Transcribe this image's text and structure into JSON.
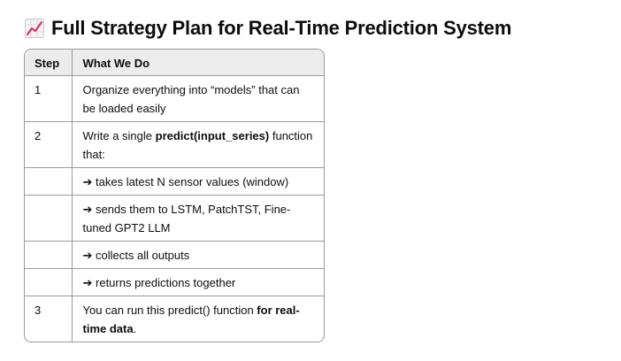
{
  "heading": {
    "icon": "chart-increasing-icon",
    "title": "Full Strategy Plan for Real-Time Prediction System"
  },
  "table": {
    "headers": {
      "step": "Step",
      "what": "What We Do"
    },
    "rows": [
      {
        "step": "1",
        "text": "Organize everything into “models” that can be loaded easily"
      },
      {
        "step": "2",
        "text_before": "Write a single ",
        "bold": "predict(input_series)",
        "text_after": " function that:"
      },
      {
        "step": "",
        "text": "➔ takes latest N sensor values (window)"
      },
      {
        "step": "",
        "text": "➔ sends them to LSTM, PatchTST, Fine-tuned GPT2 LLM"
      },
      {
        "step": "",
        "text": "➔ collects all outputs"
      },
      {
        "step": "",
        "text": "➔ returns predictions together"
      },
      {
        "step": "3",
        "text_before": "You can run this predict() function ",
        "bold": "for real-time data",
        "text_after": "."
      }
    ]
  },
  "colors": {
    "header_bg": "#ececec",
    "border": "#9a9a9a",
    "icon_line": "#e0245e"
  }
}
